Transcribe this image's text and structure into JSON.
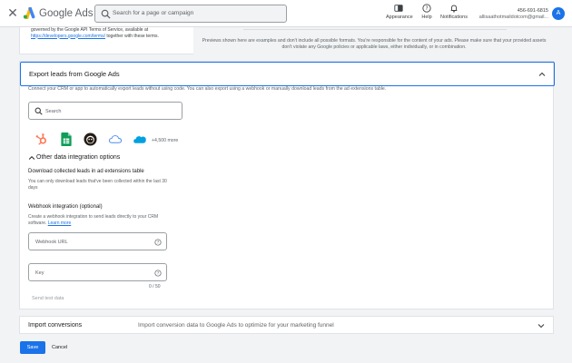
{
  "header": {
    "brand": "Google Ads",
    "search_placeholder": "Search for a page or campaign",
    "appearance": "Appearance",
    "help": "Help",
    "notifications": "Notifications",
    "account_phone": "456-691-6815",
    "account_email": "allisaathotmaildotcom@gmail..."
  },
  "avatar_letter": "A",
  "top_card": {
    "terms_text_1": "governed by the Google API Terms of Service, available at",
    "terms_link": "https://developers.google.com/terms/",
    "terms_text_2": "together with these terms.",
    "preview_note": "Previews shown here are examples and don't include all possible formats. You're responsible for the content of your ads. Please make sure that your provided assets don't violate any Google policies or applicable laws, either individually, or in combination."
  },
  "export_section": {
    "title": "Export leads from Google Ads",
    "description": "Connect your CRM or app to automatically export leads without using code. You can also export using a webhook or manually download leads from the ad extensions table.",
    "search_placeholder": "Search",
    "more_label": "+4,500 more",
    "other_options_label": "Other data integration options",
    "download_title": "Download collected leads in ad extensions table",
    "download_desc": "You can only download leads that've been collected within the last 30 days",
    "webhook_title": "Webhook integration (optional)",
    "webhook_desc": "Create a webhook integration to send leads directly to your CRM software.",
    "learn_more": "Learn more",
    "webhook_url_placeholder": "Webhook URL",
    "key_placeholder": "Key",
    "key_counter": "0 / 50",
    "send_test": "Send test data"
  },
  "integrations": [
    {
      "icon": "hubspot-icon",
      "color": "#ff7a59"
    },
    {
      "icon": "google-sheets-icon",
      "color": "#0f9d58"
    },
    {
      "icon": "mailchimp-icon",
      "color": "#241c15"
    },
    {
      "icon": "cloud-icon",
      "color": "#4c8bf5"
    },
    {
      "icon": "salesforce-icon",
      "color": "#00a1e0"
    }
  ],
  "import_section": {
    "title": "Import conversions",
    "description": "Import conversion data to Google Ads to optimize for your marketing funnel"
  },
  "footer": {
    "save": "Save",
    "cancel": "Cancel"
  },
  "colors": {
    "accent": "#1a73e8",
    "background": "#f1f3f4"
  }
}
